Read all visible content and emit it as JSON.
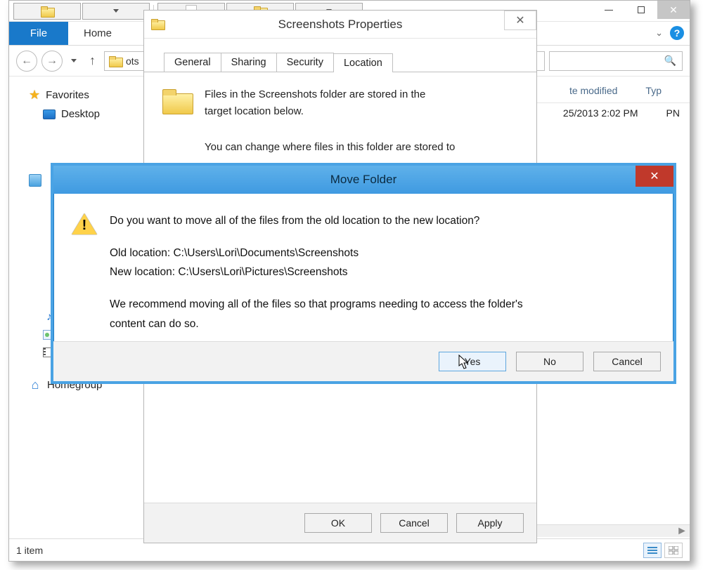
{
  "explorer": {
    "window_controls": {
      "minimize": "–",
      "maximize": "▢",
      "close": "✕"
    },
    "ribbon": {
      "file": "File",
      "home": "Home",
      "help_tooltip": "?"
    },
    "address": {
      "breadcrumb_tail": "ots",
      "search_placeholder": "",
      "search_icon_name": "search-icon"
    },
    "nav": {
      "favorites": "Favorites",
      "desktop": "Desktop",
      "music": "Music",
      "pictures": "Pictures",
      "videos": "Videos",
      "homegroup": "Homegroup"
    },
    "columns": {
      "date": "te modified",
      "type": "Typ"
    },
    "rows": [
      {
        "date": "25/2013 2:02 PM",
        "type": "PN"
      }
    ],
    "status": {
      "count": "1 item"
    }
  },
  "properties": {
    "title": "Screenshots Properties",
    "tabs": {
      "general": "General",
      "sharing": "Sharing",
      "security": "Security",
      "location": "Location"
    },
    "line1": "Files in the Screenshots folder are stored in the",
    "line2": "target location below.",
    "line3": "You can change where files in this folder are stored to",
    "buttons": {
      "ok": "OK",
      "cancel": "Cancel",
      "apply": "Apply"
    }
  },
  "move": {
    "title": "Move Folder",
    "q": "Do you want to move all of the files from the old location to the new location?",
    "old_label": "Old location: ",
    "old_path": "C:\\Users\\Lori\\Documents\\Screenshots",
    "new_label": "New location: ",
    "new_path": "C:\\Users\\Lori\\Pictures\\Screenshots",
    "rec1": "We recommend moving all of the files so that programs needing to access the folder's",
    "rec2": "content can do so.",
    "yes": "Yes",
    "no": "No",
    "cancel": "Cancel"
  }
}
